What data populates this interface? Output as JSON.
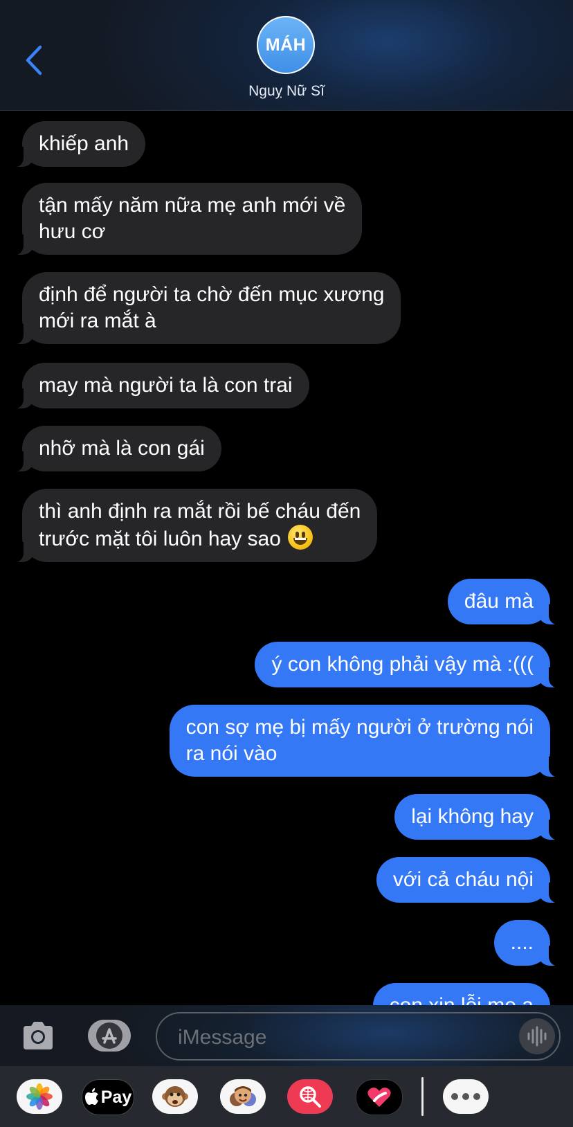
{
  "header": {
    "avatar_initials": "MÁH",
    "contact_name": "Nguỵ Nữ Sĩ"
  },
  "messages": [
    {
      "dir": "in",
      "lines": [
        "khiếp anh"
      ]
    },
    {
      "dir": "in",
      "lines": [
        "tận mấy năm nữa mẹ anh mới về",
        "hưu cơ"
      ]
    },
    {
      "dir": "in",
      "lines": [
        "định để người ta chờ đến mục xương",
        "mới ra mắt à"
      ]
    },
    {
      "dir": "in",
      "lines": [
        "may mà người ta là con trai"
      ]
    },
    {
      "dir": "in",
      "lines": [
        "nhỡ mà là con gái"
      ]
    },
    {
      "dir": "in",
      "lines": [
        "thì anh định ra mắt rồi bế cháu đến",
        "trước mặt tôi luôn hay sao"
      ],
      "emoji": "grinning-face"
    },
    {
      "dir": "out",
      "lines": [
        "đâu mà"
      ]
    },
    {
      "dir": "out",
      "lines": [
        "ý con không phải vậy mà :((("
      ]
    },
    {
      "dir": "out",
      "lines": [
        "con sợ mẹ bị mấy người ở trường nói",
        "ra nói vào"
      ]
    },
    {
      "dir": "out",
      "lines": [
        "lại không hay"
      ]
    },
    {
      "dir": "out",
      "lines": [
        "với cả cháu nội"
      ]
    },
    {
      "dir": "out",
      "lines": [
        "...."
      ]
    },
    {
      "dir": "out",
      "lines": [
        "con xin lỗi mẹ ạ"
      ]
    }
  ],
  "composer": {
    "placeholder": "iMessage"
  },
  "app_drawer": {
    "pay_label": "Pay",
    "apps": [
      "photos-icon",
      "apple-pay-icon",
      "monkey-emoji-icon",
      "memoji-icon",
      "images-search-icon",
      "digital-touch-icon",
      "more-icon"
    ]
  },
  "colors": {
    "outgoing_bubble": "#3478f6",
    "incoming_bubble": "#262629",
    "accent": "#3a82f7"
  }
}
